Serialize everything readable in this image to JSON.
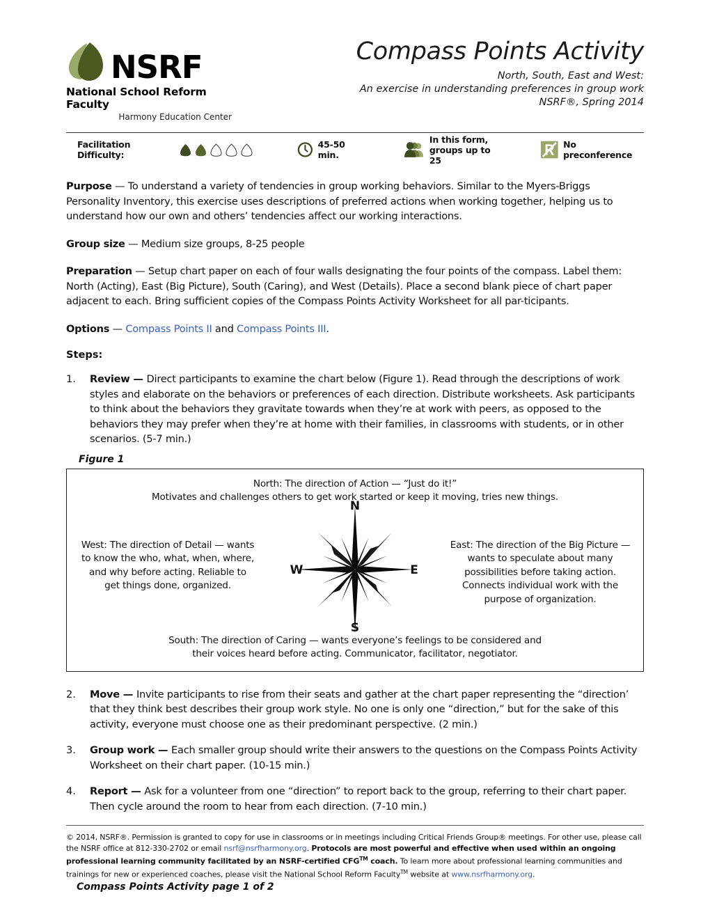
{
  "header": {
    "logo": {
      "wordmark": "NSRF",
      "org_name": "National School Reform Faculty",
      "tagline": "Harmony Education Center"
    },
    "title": "Compass Points Activity",
    "subtitle_line1": "North, South, East and West:",
    "subtitle_line2": "An exercise in understanding preferences in group work",
    "subtitle_line3": "NSRF®, Spring 2014"
  },
  "meta": {
    "difficulty_label": "Facilitation Difficulty:",
    "difficulty_filled": 2,
    "difficulty_total": 5,
    "duration": "45-50 min.",
    "group_line1": "In this form,",
    "group_line2": "groups up to 25",
    "preconference": "No preconference",
    "colors": {
      "leaf_dark": "#3f4a22",
      "leaf_mid": "#56652c",
      "leaf_light": "#9aa96a",
      "leaf_outline": "#333333"
    }
  },
  "body": {
    "purpose_label": "Purpose",
    "purpose_text": " — To understand a variety of tendencies in group working behaviors. Similar to the Myers-Briggs Personality Inventory, this exercise uses descriptions of preferred actions when working together, helping us to understand how our own and others’ tendencies affect our working interactions.",
    "groupsize_label": "Group size",
    "groupsize_text": " — Medium size groups, 8-25 people",
    "preparation_label": "Preparation",
    "preparation_text": " — Setup chart paper on each of four walls designating the four points of the compass. Label them: North (Acting), East (Big Picture), South (Caring), and West (Details). Place a second blank piece of chart paper adjacent to each. Bring sufficient copies of the Compass Points Activity Worksheet for all par-ticipants.",
    "options_label": "Options",
    "options_dash": " — ",
    "options_link1": "Compass Points II",
    "options_and": " and ",
    "options_link2": "Compass Points III",
    "options_period": ".",
    "steps_heading": "Steps:",
    "link_color": "#3b5ec0"
  },
  "steps": [
    {
      "num": "1.",
      "label": "Review — ",
      "text": " Direct participants to examine the chart below (Figure 1). Read through the descriptions of work styles and elaborate on the behaviors or preferences of each direction. Distribute worksheets. Ask participants to think about the behaviors they gravitate towards when they’re at work with peers, as opposed to the behaviors they may prefer when they’re at home with their families, in classrooms with students, or in other scenarios. (5-7 min.)"
    },
    {
      "num": "2.",
      "label": "Move — ",
      "text": " Invite participants to rise from their seats and gather at the chart paper representing the “direction’ that they think best describes their group work style. No one is only one “direction,” but for the sake of this activity, everyone must choose one as their predominant perspective.  (2 min.)"
    },
    {
      "num": "3.",
      "label": "Group work — ",
      "text": " Each smaller group should write their answers to the questions on the Compass Points Activity Worksheet on their chart paper. (10-15 min.)"
    },
    {
      "num": "4.",
      "label": "Report — ",
      "text": " Ask for a volunteer from one “direction” to report back to the group, referring to their chart paper.  Then cycle around the room to hear from each direction. (7-10 min.)"
    }
  ],
  "figure": {
    "label": "Figure 1",
    "north_line1": "North:  The direction of Action — “Just do it!”",
    "north_line2": "Motivates and challenges others to get work started or keep it moving, tries new things.",
    "west_text": "West:  The direction of Detail — wants to know the who,  what, when, where, and why before acting. Reliable to get things done, organized.",
    "east_text": "East:  The direction of the Big Picture — wants to speculate about many possibilities before taking action. Connects individual work with the  purpose of organization.",
    "south_line1": "South:  The direction of Caring — wants everyone’s feelings to be considered and",
    "south_line2": "their voices heard before acting. Communicator, facilitator, negotiator.",
    "compass_n": "N",
    "compass_s": "S",
    "compass_e": "E",
    "compass_w": "W"
  },
  "footer": {
    "copy_part1": "© 2014, NSRF®. Permission is granted to copy for use in classrooms or in meetings including Critical Friends Group® meetings. For other use, please call the NSRF office at 812-330-2702 or email ",
    "email_link": "nsrf@nsrfharmony.org",
    "copy_part2": ". ",
    "bold_part": "Protocols are most powerful and effective when used within an ongoing professional learning community facilitated by an NSRF-certified CFG",
    "bold_tm": "TM",
    "bold_part2": " coach.",
    "copy_part3": " To learn more about professional learning communities and trainings for new or experienced coaches, please visit the National School Reform Faculty",
    "copy_tm": "TM",
    "copy_part4": " website at ",
    "web_link": "www.nsrfharmony.org",
    "copy_part5": ".",
    "page_label": "Compass Points Activity  page 1 of 2"
  }
}
